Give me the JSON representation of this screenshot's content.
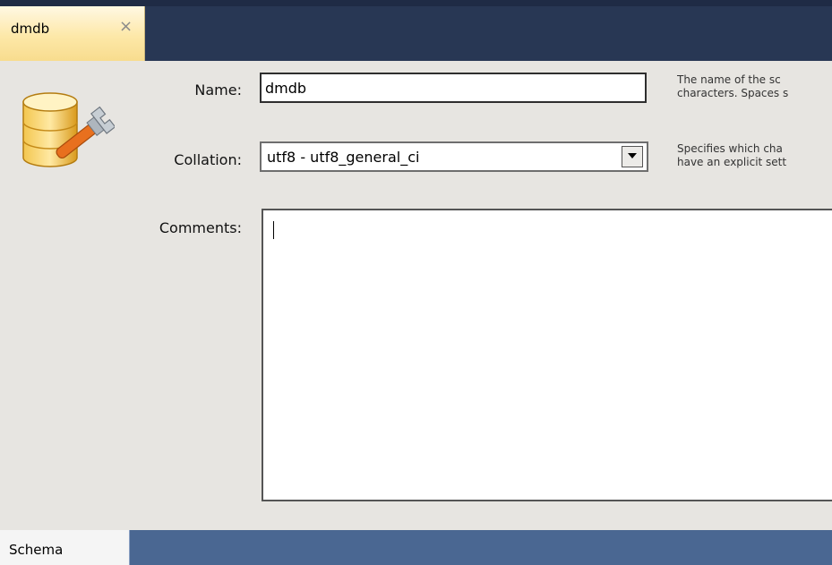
{
  "tab": {
    "title": "dmdb",
    "close_glyph": "×"
  },
  "form": {
    "name_label": "Name:",
    "name_value": "dmdb",
    "name_hint_line1": "The name of the sc",
    "name_hint_line2": "characters. Spaces s",
    "collation_label": "Collation:",
    "collation_value": "utf8 - utf8_general_ci",
    "collation_hint_line1": "Specifies which cha",
    "collation_hint_line2": "have an explicit sett",
    "comments_label": "Comments:",
    "comments_value": ""
  },
  "bottom": {
    "schema_tab": "Schema"
  },
  "icons": [
    "database-settings-icon",
    "dropdown-arrow-icon"
  ],
  "colors": {
    "tabstrip": "#283754",
    "active_tab": "#fde8a8",
    "panel": "#e7e5e1",
    "bottom_bar": "#4a6792"
  }
}
